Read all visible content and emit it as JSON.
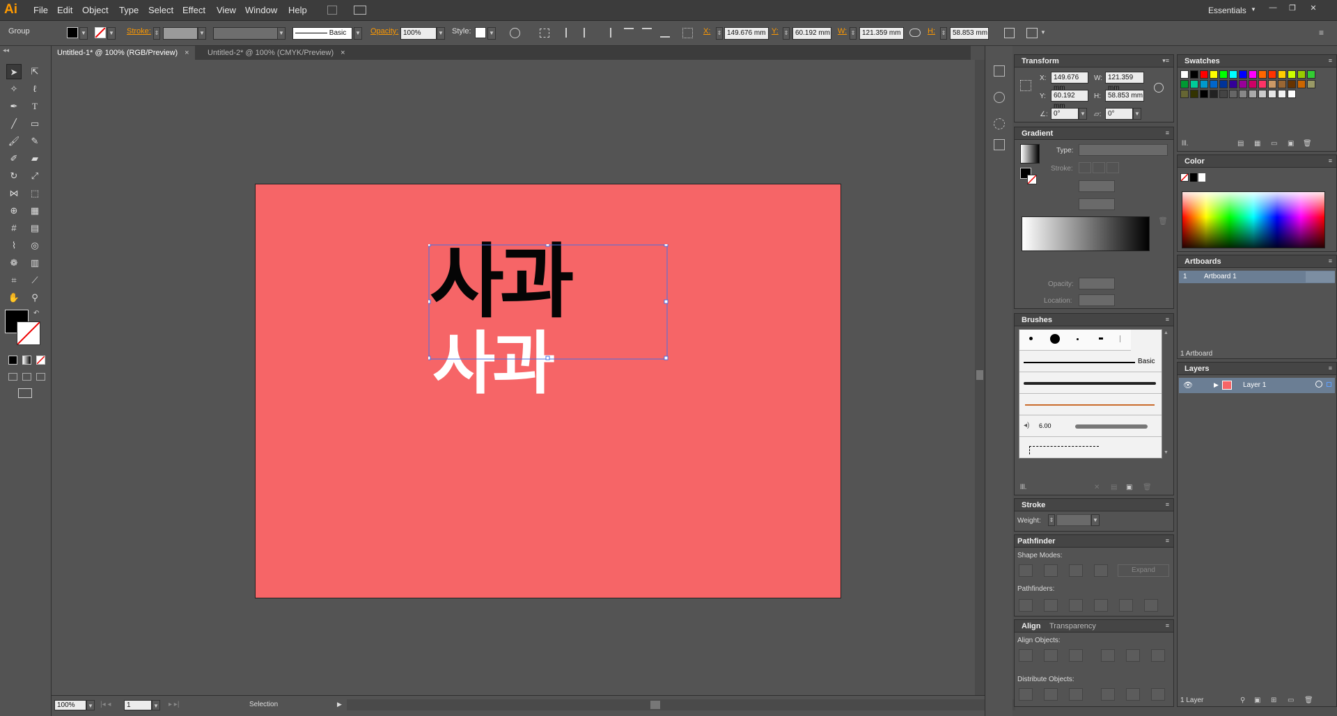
{
  "app": {
    "logo": "Ai"
  },
  "menus": [
    "File",
    "Edit",
    "Object",
    "Type",
    "Select",
    "Effect",
    "View",
    "Window",
    "Help"
  ],
  "workspace": "Essentials",
  "control": {
    "selection_type": "Group",
    "stroke_label": "Stroke:",
    "brush_label": "Basic",
    "opacity_label": "Opacity:",
    "opacity_value": "100%",
    "style_label": "Style:",
    "x_label": "X:",
    "x_value": "149.676 mm",
    "y_label": "Y:",
    "y_value": "60.192 mm",
    "w_label": "W:",
    "w_value": "121.359 mm",
    "h_label": "H:",
    "h_value": "58.853 mm"
  },
  "tabs": [
    {
      "label": "Untitled-1* @ 100% (RGB/Preview)",
      "close": "×"
    },
    {
      "label": "Untitled-2* @ 100% (CMYK/Preview)",
      "close": "×"
    }
  ],
  "artwork": {
    "text": "사과",
    "artboard_color": "#f66567"
  },
  "status": {
    "zoom": "100%",
    "page": "1",
    "tool": "Selection"
  },
  "transform": {
    "title": "Transform",
    "x_label": "X:",
    "x": "149.676 mm",
    "y_label": "Y:",
    "y": "60.192 mm",
    "w_label": "W:",
    "w": "121.359 mm",
    "h_label": "H:",
    "h": "58.853 mm",
    "angle": "0°",
    "shear": "0°"
  },
  "gradient": {
    "title": "Gradient",
    "type_label": "Type:",
    "stroke_label": "Stroke:",
    "opacity_label": "Opacity:",
    "location_label": "Location:"
  },
  "brushes": {
    "title": "Brushes",
    "basic_label": "Basic",
    "size_label": "6.00"
  },
  "stroke": {
    "title": "Stroke",
    "weight_label": "Weight:"
  },
  "pathfinder": {
    "title": "Pathfinder",
    "shape_modes_label": "Shape Modes:",
    "expand_label": "Expand",
    "pathfinders_label": "Pathfinders:"
  },
  "align": {
    "title": "Align",
    "tab2": "Transparency",
    "align_objects_label": "Align Objects:",
    "distribute_objects_label": "Distribute Objects:"
  },
  "swatches": {
    "title": "Swatches",
    "colors": [
      "#ffffff",
      "#000000",
      "#ff0000",
      "#ffff00",
      "#00ff00",
      "#00ffff",
      "#0000ff",
      "#ff00ff",
      "#ff6600",
      "#ff3300",
      "#ffcc00",
      "#ccff00",
      "#99cc00",
      "#33cc33",
      "#009933",
      "#00cc99",
      "#0099cc",
      "#0066cc",
      "#003399",
      "#330099",
      "#990099",
      "#cc0066",
      "#ff3366",
      "#cc9966",
      "#996633",
      "#663300",
      "#cc6600",
      "#999966",
      "#666633",
      "#333300",
      "#000000",
      "#222222",
      "#444444",
      "#666666",
      "#888888",
      "#aaaaaa",
      "#cccccc",
      "#e6e6e6",
      "#f2f2f2",
      "#ffffff"
    ]
  },
  "color": {
    "title": "Color"
  },
  "artboards": {
    "title": "Artboards",
    "items": [
      {
        "index": "1",
        "name": "Artboard 1"
      }
    ],
    "count_label": "1 Artboard"
  },
  "layers": {
    "title": "Layers",
    "items": [
      {
        "name": "Layer 1"
      }
    ],
    "count_label": "1 Layer"
  }
}
